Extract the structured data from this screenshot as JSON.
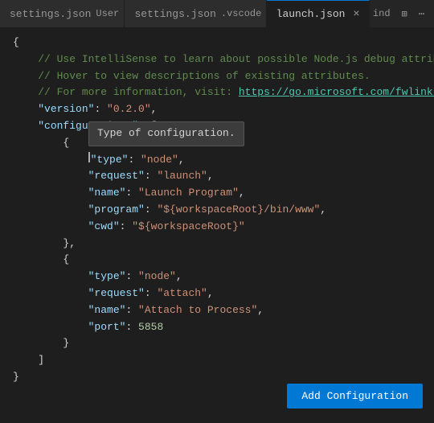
{
  "tabs": [
    {
      "id": "settings-user",
      "label": "settings.json",
      "suffix": "User",
      "active": false,
      "modified": false
    },
    {
      "id": "settings-vscode",
      "label": "settings.json",
      "suffix": ".vscode",
      "active": false,
      "modified": false
    },
    {
      "id": "launch-json",
      "label": "launch.json",
      "suffix": "",
      "active": true,
      "modified": true
    }
  ],
  "tab_bar_right": {
    "ind_label": "ind",
    "split_icon": "⊞",
    "more_icon": "⋯"
  },
  "tooltip": {
    "text": "Type of configuration."
  },
  "code_lines": [
    {
      "text": "{",
      "indent": 0
    },
    {
      "type": "comment",
      "text": "// Use IntelliSense to learn about possible Node.js debug attribute"
    },
    {
      "type": "comment",
      "text": "// Hover to view descriptions of existing attributes."
    },
    {
      "type": "comment_link",
      "text": "// For more information, visit: https://go.microsoft.com/fwlink/?li"
    },
    {
      "text": "\"version\": \"0.2.0\","
    },
    {
      "text": "\"configurations\": ["
    },
    {
      "text": "    {"
    },
    {
      "text": "        \"type\": \"node\","
    },
    {
      "text": "        \"request\": \"launch\","
    },
    {
      "text": "        \"name\": \"Launch Program\","
    },
    {
      "text": "        \"program\": \"${workspaceRoot}/bin/www\","
    },
    {
      "text": "        \"cwd\": \"${workspaceRoot}\""
    },
    {
      "text": "    },"
    },
    {
      "text": "    {"
    },
    {
      "text": "        \"type\": \"node\","
    },
    {
      "text": "        \"request\": \"attach\","
    },
    {
      "text": "        \"name\": \"Attach to Process\","
    },
    {
      "text": "        \"port\": 5858"
    },
    {
      "text": "    }"
    },
    {
      "text": "]"
    },
    {
      "text": "}"
    }
  ],
  "add_config_button": {
    "label": "Add Configuration"
  }
}
